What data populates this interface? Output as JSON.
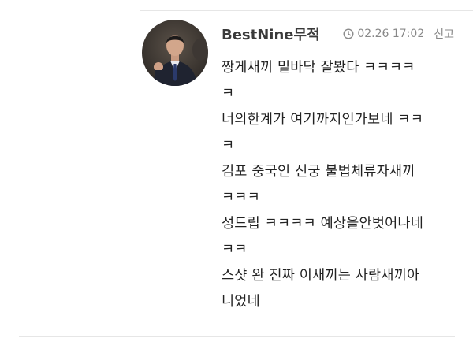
{
  "comment": {
    "author": "BestNine무적",
    "timestamp": "02.26 17:02",
    "report_label": "신고",
    "icons": {
      "time": "clock-icon",
      "avatar": "user-avatar-photo"
    },
    "lines": [
      "짱게새끼 밑바닥 잘봤다 ㅋㅋㅋㅋ",
      "ㅋ",
      "너의한계가 여기까지인가보네 ㅋㅋ",
      "ㅋ",
      "김포 중국인 신궁 불법체류자새끼",
      "ㅋㅋㅋ",
      "성드립 ㅋㅋㅋㅋ 예상을안벗어나네",
      "ㅋㅋ",
      "스샷 완  진짜 이새끼는 사람새끼아",
      "니었네"
    ]
  },
  "colors": {
    "author": "#3a3a3a",
    "meta": "#888888",
    "text": "#222222",
    "divider": "#e6e6e6"
  }
}
